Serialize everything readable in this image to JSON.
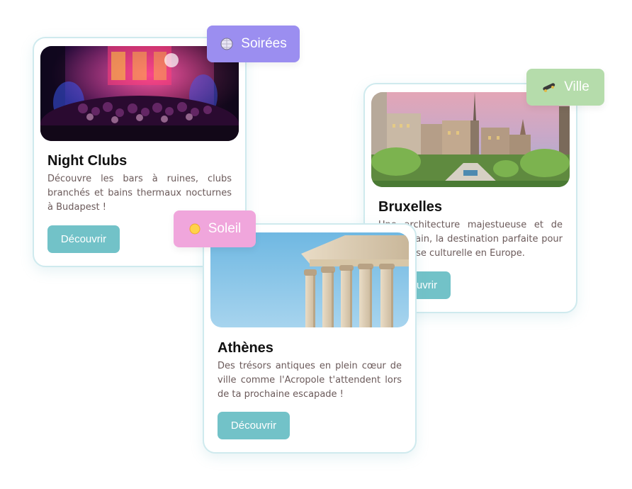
{
  "cards": {
    "nightclubs": {
      "title": "Night Clubs",
      "description": "Découvre les bars à ruines, clubs branchés et bains thermaux nocturnes à Budapest !",
      "button": "Découvrir",
      "image_icon": "nightclub-photo"
    },
    "bruxelles": {
      "title": "Bruxelles",
      "description": "Une architecture majestueuse et de l'art urbain, la destination parfaite pour une pause culturelle en Europe.",
      "button": "Découvrir",
      "image_icon": "brussels-photo"
    },
    "athenes": {
      "title": "Athènes",
      "description": "Des trésors antiques en plein cœur de ville comme l'Acropole t'attendent lors de ta prochaine escapade !",
      "button": "Découvrir",
      "image_icon": "acropolis-photo"
    }
  },
  "tags": {
    "soirees": {
      "label": "Soirées",
      "icon": "disco-ball-icon",
      "color": "#9b8ef0"
    },
    "ville": {
      "label": "Ville",
      "icon": "skateboard-icon",
      "color": "#b5dcab"
    },
    "soleil": {
      "label": "Soleil",
      "icon": "sun-icon",
      "color": "#f0a6dc"
    }
  },
  "colors": {
    "button": "#72c2c8",
    "card_border": "#cfeaee",
    "title": "#111111",
    "description": "#6b5a5a"
  }
}
